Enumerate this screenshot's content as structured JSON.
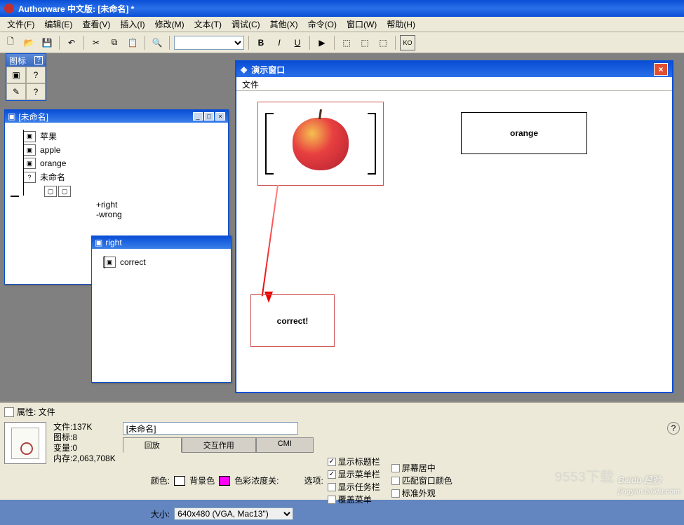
{
  "title": "Authorware 中文版: [未命名] *",
  "menu": [
    "文件(F)",
    "编辑(E)",
    "查看(V)",
    "插入(I)",
    "修改(M)",
    "文本(T)",
    "调试(C)",
    "其他(X)",
    "命令(O)",
    "窗口(W)",
    "帮助(H)"
  ],
  "palette_title": "图标",
  "flow_win": {
    "title": "[未命名]",
    "items": [
      "苹果",
      "apple",
      "orange",
      "未命名"
    ],
    "branches": [
      "+right",
      "-wrong"
    ]
  },
  "right_win": {
    "title": "right",
    "item": "correct"
  },
  "presentation": {
    "title": "演示窗口",
    "menu": "文件",
    "orange_label": "orange",
    "correct_label": "correct!"
  },
  "props": {
    "title": "属性: 文件",
    "stats": {
      "file": "文件:137K",
      "icons": "图标:8",
      "vars": "变量:0",
      "mem": "内存:2,063,708K"
    },
    "name_value": "[未命名]",
    "tabs": [
      "回放",
      "交互作用",
      "CMI"
    ],
    "color_label": "颜色:",
    "bg_label": "背景色",
    "chroma_label": "色彩浓度关:",
    "size_label": "大小:",
    "size_value": "640x480 (VGA, Mac13\")",
    "options_label": "选项:",
    "opts_left": [
      "显示标题栏",
      "显示菜单栏",
      "显示任务栏",
      "覆盖菜单"
    ],
    "opts_right": [
      "屏幕居中",
      "匹配窗口颜色",
      "标准外观"
    ],
    "checked": [
      true,
      true,
      false,
      false,
      false,
      false,
      false
    ]
  },
  "watermark": "9553下载",
  "wm_main": "Baidu 经验",
  "wm_sub": "jingyan.baidu.com"
}
